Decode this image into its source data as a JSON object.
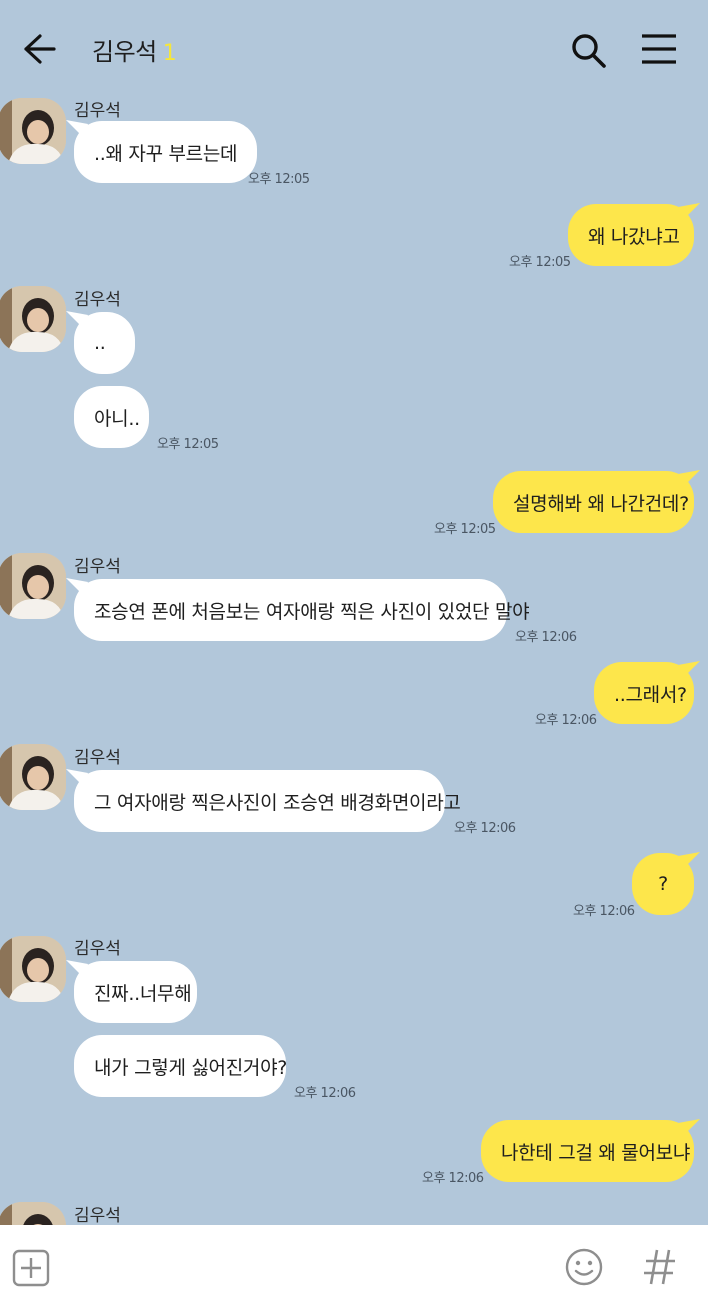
{
  "header": {
    "title": "김우석",
    "member_count": "1"
  },
  "messages": [
    {
      "type": "in",
      "sender": "김우석",
      "text": "..왜 자꾸 부르는데",
      "time": "오후 12:05"
    },
    {
      "type": "out",
      "text": "왜 나갔냐고",
      "time": "오후 12:05"
    },
    {
      "type": "in",
      "sender": "김우석",
      "text": "..",
      "time": ""
    },
    {
      "type": "in",
      "text": "아니..",
      "time": "오후 12:05"
    },
    {
      "type": "out",
      "text": "설명해봐 왜 나간건데?",
      "time": "오후 12:05"
    },
    {
      "type": "in",
      "sender": "김우석",
      "text": "조승연 폰에 처음보는 여자애랑 찍은 사진이 있었단 말야",
      "time": "오후 12:06"
    },
    {
      "type": "out",
      "text": "..그래서?",
      "time": "오후 12:06"
    },
    {
      "type": "in",
      "sender": "김우석",
      "text": "그 여자애랑 찍은사진이 조승연 배경화면이라고",
      "time": "오후 12:06"
    },
    {
      "type": "out",
      "text": "?",
      "time": "오후 12:06"
    },
    {
      "type": "in",
      "sender": "김우석",
      "text": "진짜..너무해",
      "time": ""
    },
    {
      "type": "in",
      "text": "내가 그렇게 싫어진거야?",
      "time": "오후 12:06"
    },
    {
      "type": "out",
      "text": "나한테 그걸 왜 물어보냐",
      "time": "오후 12:06"
    },
    {
      "type": "in",
      "sender": "김우석"
    }
  ],
  "icons": {
    "back": "back-arrow-icon",
    "search": "search-icon",
    "menu": "menu-icon",
    "attach": "plus-icon",
    "emoji": "emoji-icon",
    "hash": "hashtag-icon"
  },
  "colors": {
    "background": "#b2c7da",
    "outgoing_bubble": "#fde64b",
    "incoming_bubble": "#ffffff"
  }
}
